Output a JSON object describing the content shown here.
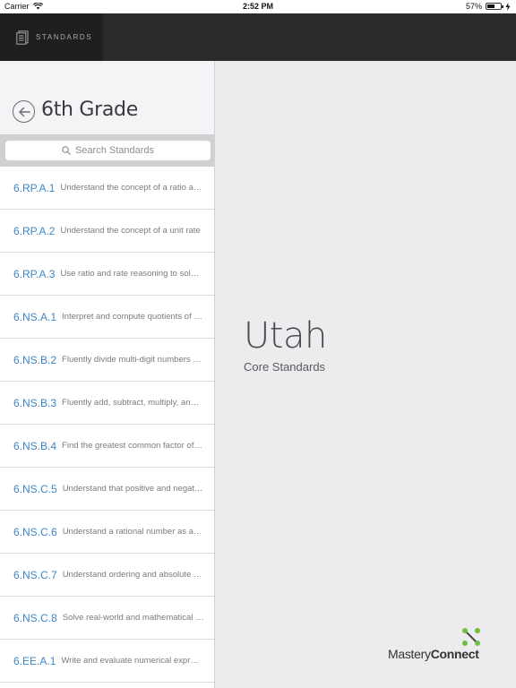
{
  "status": {
    "carrier": "Carrier",
    "time": "2:52 PM",
    "battery": "57%",
    "battery_level": 0.57
  },
  "nav": {
    "standards_label": "STANDARDS"
  },
  "sidebar": {
    "title": "6th Grade",
    "search_placeholder": "Search Standards",
    "items": [
      {
        "code": "6.RP.A.1",
        "desc": "Understand the concept of a ratio and use ratio language"
      },
      {
        "code": "6.RP.A.2",
        "desc": "Understand the concept of a unit rate"
      },
      {
        "code": "6.RP.A.3",
        "desc": "Use ratio and rate reasoning to solve problems"
      },
      {
        "code": "6.NS.A.1",
        "desc": "Interpret and compute quotients of fractions"
      },
      {
        "code": "6.NS.B.2",
        "desc": "Fluently divide multi-digit numbers using the standard algorithm"
      },
      {
        "code": "6.NS.B.3",
        "desc": "Fluently add, subtract, multiply, and divide multi-digit decimals"
      },
      {
        "code": "6.NS.B.4",
        "desc": "Find the greatest common factor of two whole numbers"
      },
      {
        "code": "6.NS.C.5",
        "desc": "Understand that positive and negative numbers are used together"
      },
      {
        "code": "6.NS.C.6",
        "desc": "Understand a rational number as a point on the number line"
      },
      {
        "code": "6.NS.C.7",
        "desc": "Understand ordering and absolute value of rational numbers"
      },
      {
        "code": "6.NS.C.8",
        "desc": "Solve real-world and mathematical problems by graphing points"
      },
      {
        "code": "6.EE.A.1",
        "desc": "Write and evaluate numerical expressions involving exponents"
      }
    ]
  },
  "main": {
    "state": "Utah",
    "subtitle": "Core Standards"
  },
  "brand": {
    "name_light": "Mastery",
    "name_bold": "Connect",
    "accent": "#6fbf44"
  },
  "colors": {
    "link": "#3f86c7",
    "topbar": "#2b2b2e"
  }
}
